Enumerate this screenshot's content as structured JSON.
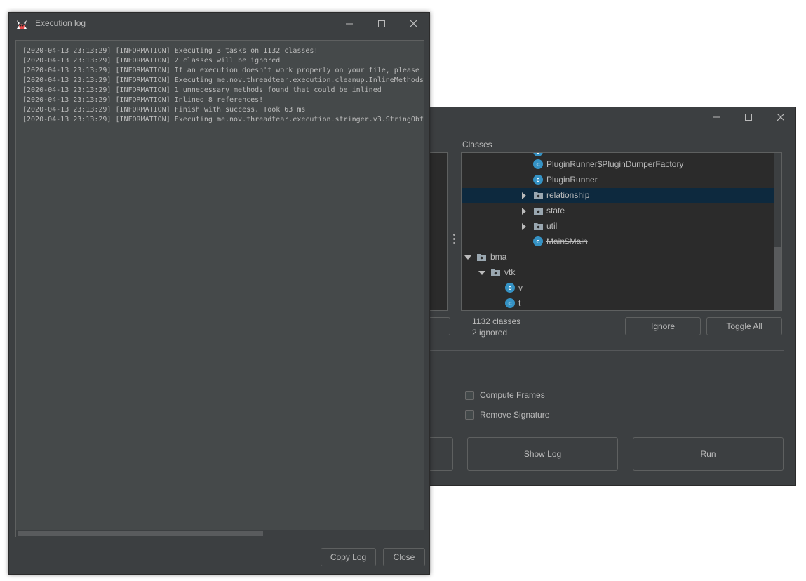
{
  "log_window": {
    "title": "Execution log",
    "lines": [
      "[2020-04-13 23:13:29] [INFORMATION] Executing 3 tasks on 1132 classes!",
      "[2020-04-13 23:13:29] [INFORMATION] 2 classes will be ignored",
      "[2020-04-13 23:13:29] [INFORMATION] If an execution doesn't work properly on your file, please c",
      "[2020-04-13 23:13:29] [INFORMATION] Executing me.nov.threadtear.execution.cleanup.InlineMethods",
      "[2020-04-13 23:13:29] [INFORMATION] 1 unnecessary methods found that could be inlined",
      "[2020-04-13 23:13:29] [INFORMATION] Inlined 8 references!",
      "[2020-04-13 23:13:29] [INFORMATION] Finish with success. Took 63 ms",
      "[2020-04-13 23:13:29] [INFORMATION] Executing me.nov.threadtear.execution.stringer.v3.StringObfu"
    ],
    "copy_log_label": "Copy Log",
    "close_label": "Close"
  },
  "main_window": {
    "classes_label": "Classes",
    "tree": [
      {
        "label": "PluginRunner$PluginDumperFactory",
        "kind": "class",
        "struck": false
      },
      {
        "label": "PluginRunner",
        "kind": "class",
        "struck": false
      },
      {
        "label": "relationship",
        "kind": "package",
        "struck": false,
        "selected": true
      },
      {
        "label": "state",
        "kind": "package",
        "struck": false
      },
      {
        "label": "util",
        "kind": "package",
        "struck": false
      },
      {
        "label": "Main$Main",
        "kind": "class",
        "struck": true
      },
      {
        "label": "bma",
        "kind": "package",
        "struck": false,
        "expanded": true
      },
      {
        "label": "vtk",
        "kind": "package",
        "struck": false,
        "expanded": true
      },
      {
        "label": "v",
        "kind": "class",
        "struck": true
      },
      {
        "label": "t",
        "kind": "class",
        "struck": false
      }
    ],
    "class_icon_letter": "c",
    "class_count": "1132 classes",
    "ignored_count": "2 ignored",
    "ignore_label": "Ignore",
    "toggle_all_label": "Toggle All",
    "compute_frames_label": "Compute Frames",
    "remove_signature_label": "Remove Signature",
    "show_log_label": "Show Log",
    "run_label": "Run"
  },
  "colors": {
    "window_bg": "#3c3f41",
    "tree_bg": "#2b2b2b",
    "selection": "#0d293e",
    "class_icon": "#3592c4",
    "text": "#bbbbbb"
  }
}
